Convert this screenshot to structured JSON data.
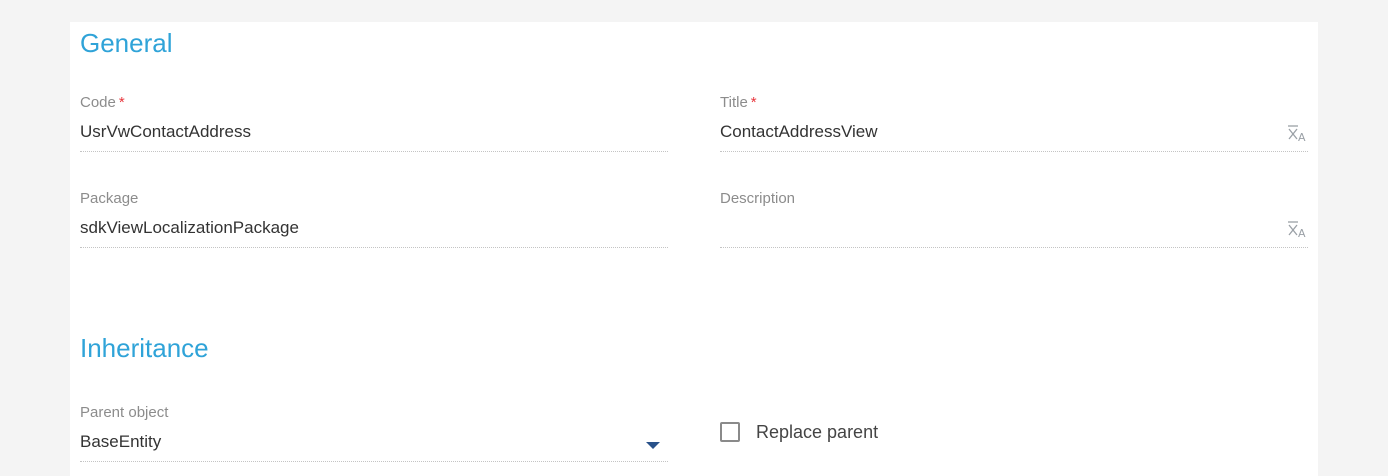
{
  "general": {
    "title": "General",
    "fields": {
      "code": {
        "label": "Code",
        "required_marker": "*",
        "value": "UsrVwContactAddress"
      },
      "title": {
        "label": "Title",
        "required_marker": "*",
        "value": "ContactAddressView"
      },
      "package": {
        "label": "Package",
        "value": "sdkViewLocalizationPackage"
      },
      "description": {
        "label": "Description",
        "value": ""
      }
    }
  },
  "inheritance": {
    "title": "Inheritance",
    "parent_object": {
      "label": "Parent object",
      "value": "BaseEntity"
    },
    "replace_parent": {
      "label": "Replace parent",
      "checked": false
    }
  },
  "icons": {
    "translate": "translate-icon",
    "dropdown": "chevron-down-icon"
  },
  "colors": {
    "accent": "#2fa3d8",
    "required": "#e8353c",
    "label": "#8c8c8c",
    "value": "#333333",
    "page_background": "#f4f4f4",
    "panel_background": "#ffffff"
  }
}
